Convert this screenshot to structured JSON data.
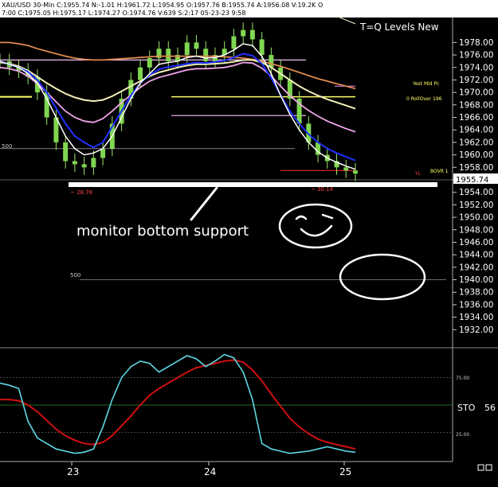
{
  "header": {
    "line1": "XAU/USD 30-Min C:1955.74 N:-1.01 H:1961.72 L:1954.95 O:1957.76 B:1955.74 A:1956.08 V:19.2K O",
    "line2": "7:00 C:1975.05 H:1975.17 L:1974.27 O:1974.76 V:639 S:2:17 05-23-23 9:58",
    "legend": "T=Q Levels New"
  },
  "annotations": {
    "support_text": "monitor bottom support",
    "left_low": "~ 28.78",
    "right_low": "~ 30.14",
    "level_500_upper": "500",
    "level_500_lower": "500",
    "yest_mid": "Yest Mid Pc",
    "rollover": "0 RollOver 196",
    "yl_label": "YL",
    "bovr_label": "BOVR 1",
    "last_price": "1955.74"
  },
  "chart_data": [
    {
      "type": "line",
      "title": "XAU/USD 30-Min",
      "x_ticks": [
        "23",
        "24",
        "25"
      ],
      "y_ticks": [
        1978,
        1976,
        1974,
        1972,
        1970,
        1968,
        1966,
        1964,
        1962,
        1960,
        1958,
        1956,
        1954,
        1952,
        1950,
        1948,
        1946,
        1944,
        1942,
        1940,
        1938,
        1936,
        1934,
        1932
      ],
      "ylim": [
        1930,
        1982
      ],
      "last_price": 1955.74,
      "series": [],
      "price": [
        1975,
        1974,
        1973.5,
        1972.5,
        1970,
        1966,
        1962,
        1959,
        1958.5,
        1958,
        1959.5,
        1961,
        1965,
        1969,
        1972,
        1974,
        1975.5,
        1977,
        1975,
        1976,
        1978,
        1977,
        1975,
        1976,
        1977,
        1979,
        1980,
        1978.5,
        1976,
        1974,
        1972,
        1969,
        1965,
        1962,
        1960,
        1959,
        1958,
        1957.5,
        1957
      ],
      "ema_fast": [
        1975,
        1974.5,
        1974,
        1973,
        1971.5,
        1969,
        1966,
        1963,
        1961,
        1960,
        1960.3,
        1961,
        1963,
        1966,
        1969,
        1971.5,
        1973,
        1974.5,
        1974.8,
        1975,
        1975.6,
        1975.8,
        1975.5,
        1975.6,
        1976,
        1976.8,
        1977.8,
        1977.5,
        1975.8,
        1973,
        1969.5,
        1966.5,
        1964,
        1962,
        1960.5,
        1959.5,
        1958.8,
        1958.2,
        1957.7
      ],
      "ema_blue": [
        1975,
        1974.5,
        1974,
        1973.3,
        1972,
        1970,
        1967.5,
        1965,
        1963,
        1962,
        1961.2,
        1962,
        1964.5,
        1967,
        1969.5,
        1971.5,
        1972.8,
        1973.7,
        1974.1,
        1974.3,
        1974.6,
        1974.8,
        1974.7,
        1974.9,
        1975.1,
        1975.6,
        1976.2,
        1975.9,
        1974.6,
        1972.3,
        1969.6,
        1967,
        1965,
        1963.3,
        1962,
        1961,
        1960.3,
        1959.7,
        1959.1
      ],
      "ema_pink": [
        1974,
        1973.8,
        1973.4,
        1972.6,
        1971.4,
        1970,
        1968.5,
        1967,
        1966,
        1965.4,
        1965.2,
        1965.8,
        1967,
        1968.4,
        1969.6,
        1970.8,
        1971.8,
        1972.4,
        1972.8,
        1973.2,
        1973.6,
        1973.8,
        1973.8,
        1973.9,
        1974,
        1974.3,
        1974.8,
        1974.7,
        1973.9,
        1972.6,
        1971,
        1969.5,
        1968.2,
        1967.1,
        1966.2,
        1965.4,
        1964.8,
        1964.2,
        1963.7
      ],
      "ema_cream": [
        1974.8,
        1974.6,
        1974.2,
        1973.5,
        1972.5,
        1971.5,
        1970.6,
        1969.8,
        1969.2,
        1968.8,
        1968.6,
        1968.8,
        1969.4,
        1970.2,
        1971,
        1971.8,
        1972.6,
        1973.2,
        1973.6,
        1974,
        1974.3,
        1974.5,
        1974.5,
        1974.6,
        1974.7,
        1974.9,
        1975.2,
        1975.2,
        1974.8,
        1974,
        1973,
        1972,
        1971,
        1970.2,
        1969.5,
        1968.9,
        1968.4,
        1967.9,
        1967.4
      ],
      "ema_orange": [
        1978,
        1978,
        1977.8,
        1977.5,
        1977,
        1976.6,
        1976.2,
        1975.8,
        1975.5,
        1975.3,
        1975.2,
        1975.2,
        1975.3,
        1975.4,
        1975.5,
        1975.6,
        1975.7,
        1975.8,
        1975.8,
        1975.8,
        1975.8,
        1975.8,
        1975.8,
        1975.8,
        1975.7,
        1975.6,
        1975.5,
        1975.3,
        1975,
        1974.6,
        1974.2,
        1973.7,
        1973.2,
        1972.7,
        1972.2,
        1971.8,
        1971.4,
        1971,
        1970.6
      ]
    },
    {
      "type": "line",
      "title": "STO",
      "indicator_value": "56",
      "y_ticks": [
        "75.00",
        "25.00"
      ],
      "ylim": [
        0,
        100
      ],
      "x_ticks": [
        "23",
        "24",
        "25"
      ],
      "k": [
        70,
        68,
        65,
        35,
        20,
        15,
        10,
        8,
        6,
        7,
        10,
        30,
        55,
        75,
        85,
        90,
        88,
        80,
        85,
        90,
        95,
        92,
        85,
        90,
        96,
        93,
        80,
        55,
        15,
        10,
        8,
        6,
        7,
        8,
        10,
        12,
        10,
        8,
        7
      ],
      "d": [
        55,
        55,
        54,
        50,
        44,
        36,
        28,
        22,
        18,
        15,
        14,
        16,
        22,
        31,
        40,
        50,
        59,
        65,
        70,
        75,
        80,
        84,
        86,
        88,
        90,
        91,
        89,
        82,
        72,
        60,
        49,
        38,
        30,
        24,
        19,
        16,
        14,
        12,
        10
      ]
    }
  ]
}
